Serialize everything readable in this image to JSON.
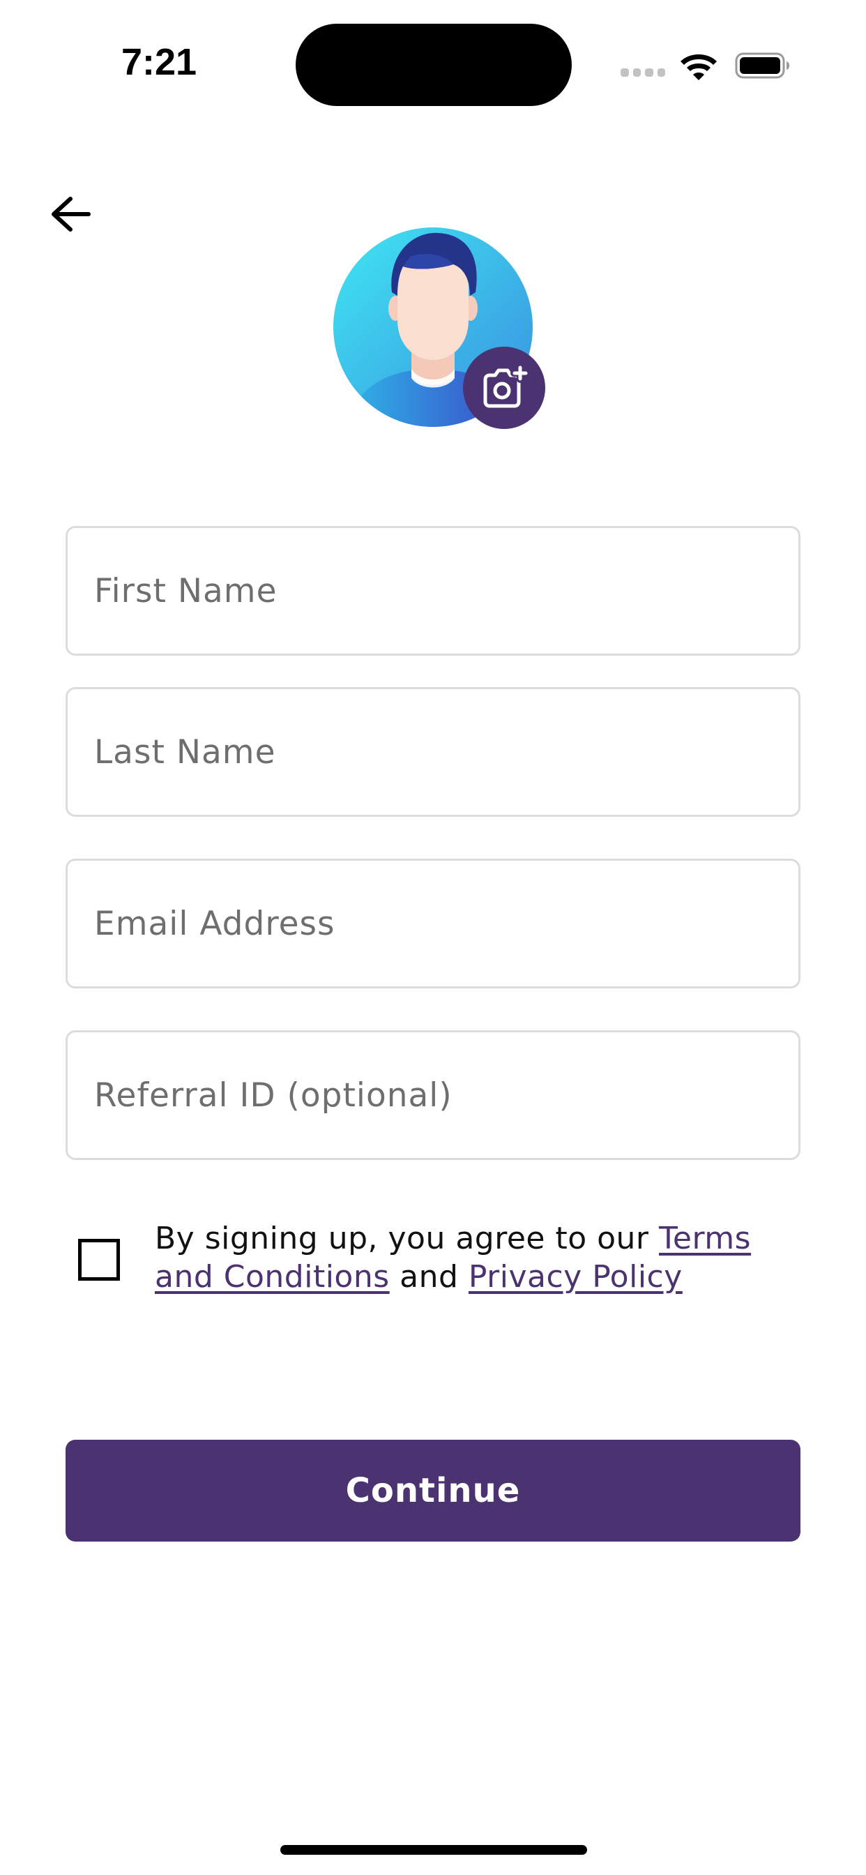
{
  "status_bar": {
    "time": "7:21"
  },
  "nav": {
    "back_icon": "arrow-left-icon"
  },
  "profile": {
    "avatar_icon": "user-avatar-icon",
    "camera_icon": "camera-add-icon",
    "camera_button_color": "#4b3270"
  },
  "form": {
    "first_name": {
      "placeholder": "First Name",
      "value": ""
    },
    "last_name": {
      "placeholder": "Last Name",
      "value": ""
    },
    "email": {
      "placeholder": "Email Address",
      "value": ""
    },
    "referral": {
      "placeholder": "Referral ID (optional)",
      "value": ""
    }
  },
  "terms": {
    "checked": false,
    "prefix": "By signing up, you agree to our ",
    "terms_link": "Terms and Conditions",
    "middle": " and ",
    "privacy_link": "Privacy Policy"
  },
  "actions": {
    "continue_label": "Continue"
  },
  "colors": {
    "accent": "#4b3270",
    "input_border": "#dcdcdc"
  }
}
